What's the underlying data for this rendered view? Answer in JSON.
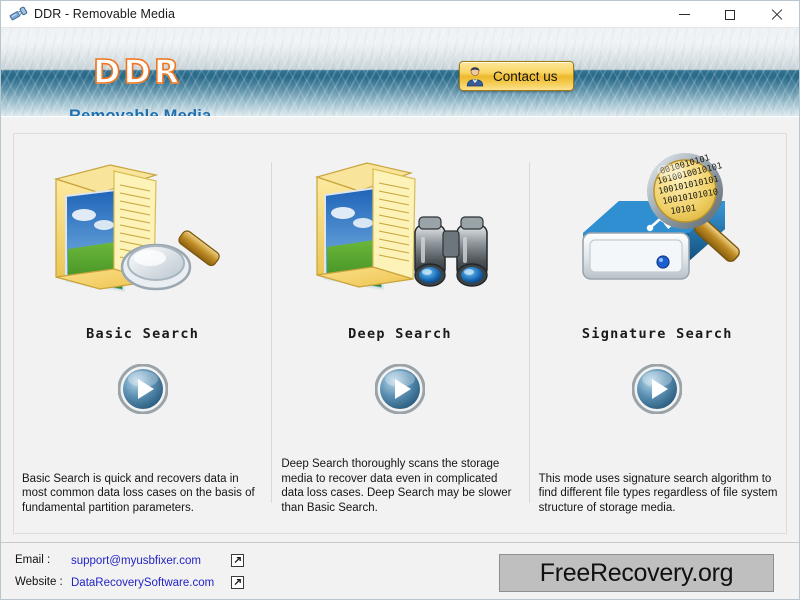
{
  "window": {
    "title": "DDR - Removable Media",
    "icon": "usb-connector-icon",
    "controls": {
      "minimize": "minimize-button",
      "maximize": "maximize-button",
      "close": "close-button"
    }
  },
  "header": {
    "logo": "DDR",
    "subtitle": "Removable Media",
    "contact_label": "Contact us",
    "contact_icon": "user-avatar-icon",
    "accent_orange": "#f2741c",
    "accent_blue": "#1f6fae",
    "band_blue": "#2d6f8f"
  },
  "modes": [
    {
      "title": "Basic Search",
      "icon": "folder-document-magnifier-icon",
      "button": "start-basic-search-button",
      "description": "Basic Search is quick and recovers data in most common data loss cases on the basis of fundamental partition parameters."
    },
    {
      "title": "Deep Search",
      "icon": "folder-document-binoculars-icon",
      "button": "start-deep-search-button",
      "description": "Deep Search thoroughly scans the storage media to recover data even in complicated data loss cases. Deep Search may be slower than Basic Search."
    },
    {
      "title": "Signature Search",
      "icon": "usb-drive-binary-magnifier-icon",
      "button": "start-signature-search-button",
      "description": "This mode uses signature search algorithm to find different file types regardless of file system structure of storage media."
    }
  ],
  "footer": {
    "email_label": "Email :",
    "email_value": "support@myusbfixer.com",
    "website_label": "Website :",
    "website_value": "DataRecoverySoftware.com",
    "external_icon": "external-link-icon",
    "link_color": "#2323c4",
    "watermark": "FreeRecovery.org"
  }
}
